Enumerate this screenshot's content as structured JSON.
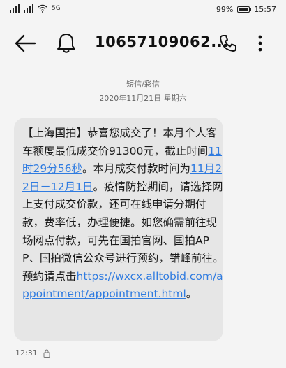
{
  "status_bar": {
    "left_small": "5G",
    "battery": "99%",
    "time": "15:57",
    "battery_level": 0.99
  },
  "header": {
    "phone_number": "10657109062..."
  },
  "meta": {
    "type_label": "短信/彩信",
    "datetime": "2020年11月21日 星期六"
  },
  "message": {
    "part1": "【上海国拍】恭喜您成交了！本月个人客车额度最低成交价91300元，截止时间",
    "deadline_time": "11时29分56秒",
    "part2": "。本月成交付款时间为",
    "payment_period": "11月22日－12月1日",
    "part3": "。疫情防控期间，请选择网上支付成交价款，还可在线申请分期付款，费率低，办理便捷。如您确需前往现场网点付款，可先在国拍官网、国拍APP、国拍微信公众号进行预约，错峰前往。预约请点击",
    "url": "https://wxcx.alltobid.com/appointment/appointment.html",
    "part4": "。"
  },
  "footer": {
    "time": "12:31"
  },
  "icons": {
    "back": "arrow-left",
    "bell": "bell",
    "phone": "phone",
    "more": "more-vertical",
    "lock": "lock"
  }
}
